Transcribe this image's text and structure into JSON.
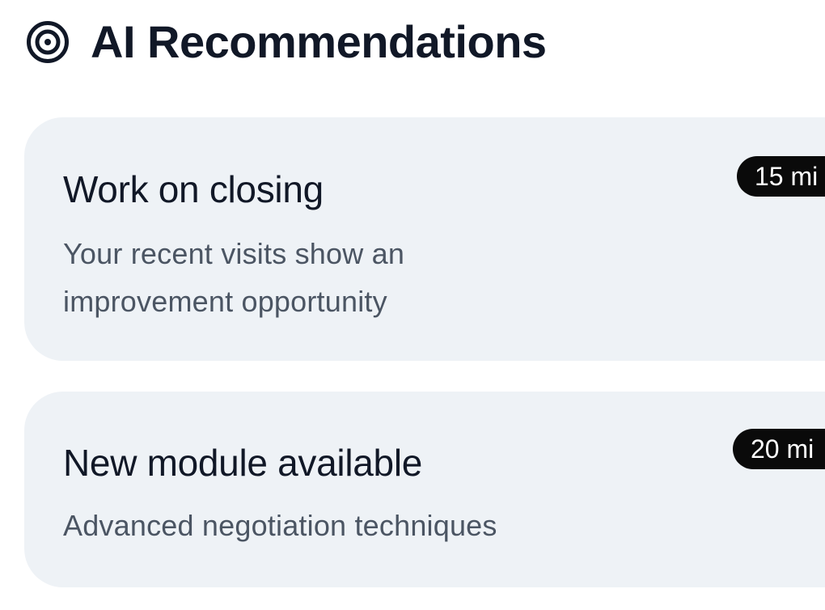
{
  "header": {
    "title": "AI Recommendations",
    "icon": "target-icon"
  },
  "recommendations": [
    {
      "title": "Work on closing",
      "description": "Your recent visits show an improvement opportunity",
      "duration": "15 mi"
    },
    {
      "title": "New module available",
      "description": "Advanced negotiation techniques",
      "duration": "20 mi"
    }
  ],
  "colors": {
    "card_background": "#eef2f6",
    "title_text": "#111827",
    "description_text": "#4b5563",
    "badge_background": "#0a0a0a",
    "badge_text": "#ffffff"
  }
}
